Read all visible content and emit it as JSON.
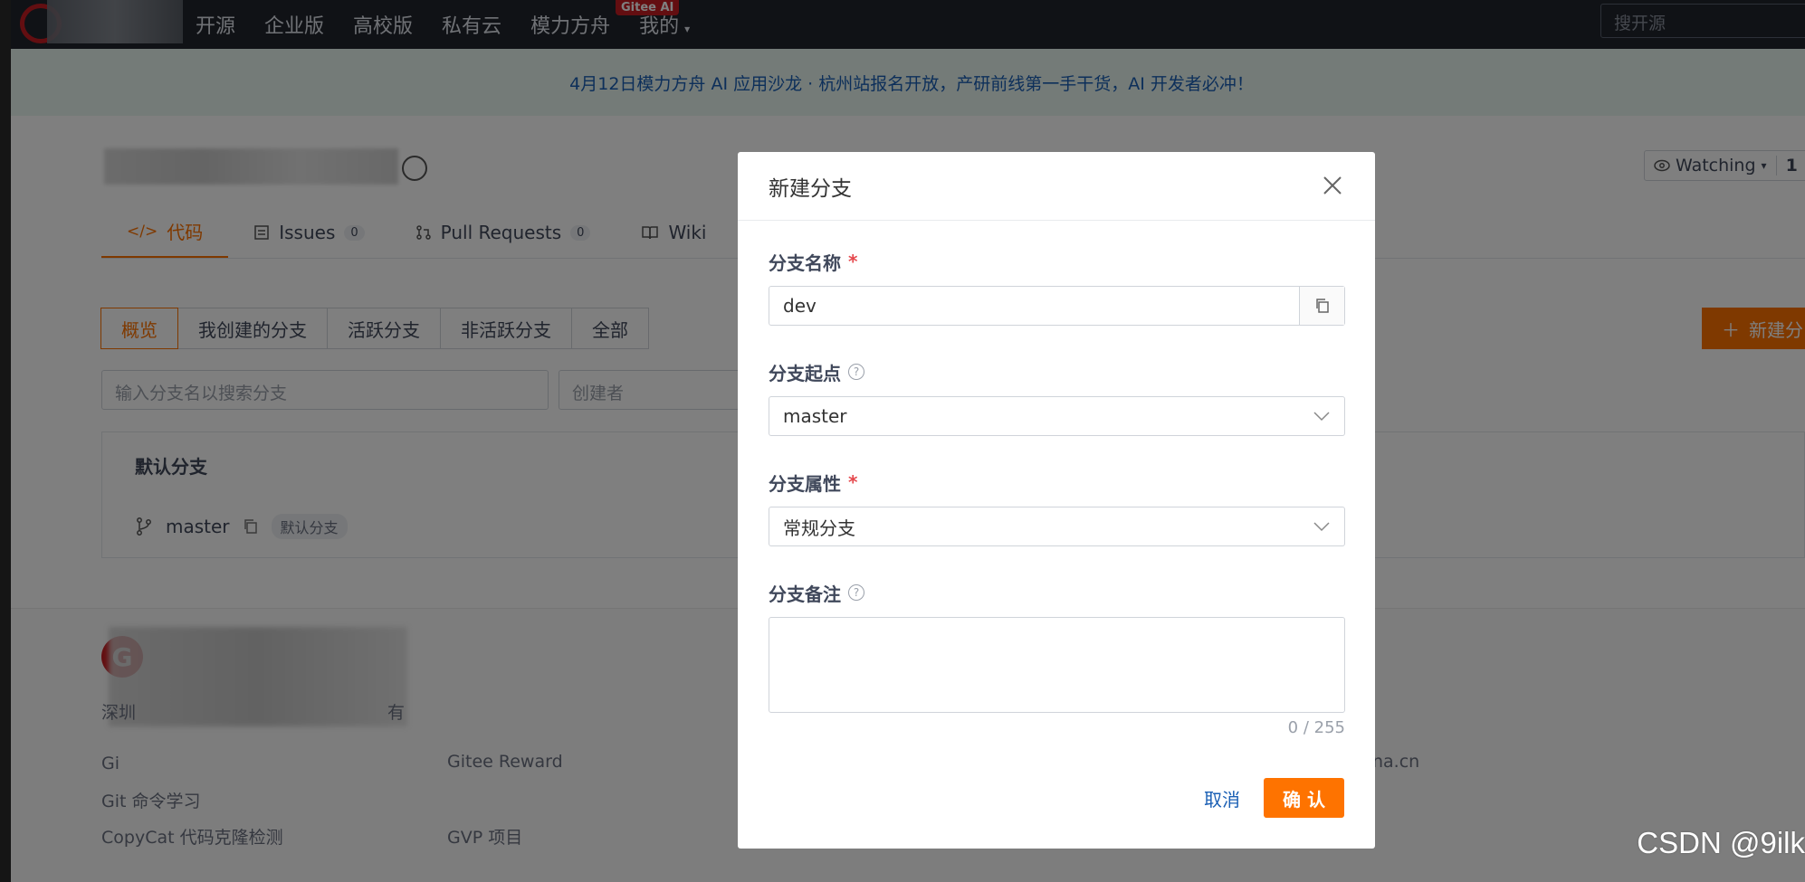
{
  "nav": {
    "items": [
      "开源",
      "企业版",
      "高校版",
      "私有云",
      "模力方舟",
      "我的"
    ],
    "badge": "Gitee AI",
    "search_placeholder": "搜开源"
  },
  "banner": {
    "text": "4月12日模力方舟 AI 应用沙龙 · 杭州站报名开放，产研前线第一手干货，AI 开发者必冲！"
  },
  "repo": {
    "tabs": [
      {
        "label": "代码",
        "icon": "code-icon"
      },
      {
        "label": "Issues",
        "count": "0",
        "icon": "issues-icon"
      },
      {
        "label": "Pull Requests",
        "count": "0",
        "icon": "pull-request-icon"
      },
      {
        "label": "Wiki",
        "icon": "wiki-icon"
      }
    ],
    "watching_label": "Watching",
    "watching_count": "1"
  },
  "branches": {
    "filter_tabs": [
      "概览",
      "我创建的分支",
      "活跃分支",
      "非活跃分支",
      "全部"
    ],
    "new_button": "新建分",
    "search_placeholder": "输入分支名以搜索分支",
    "creator_placeholder": "创建者",
    "default_title": "默认分支",
    "default_branch": "master",
    "default_badge": "默认分支"
  },
  "footer": {
    "lines": [
      "深圳",
      "有",
      "Gi",
      "Git 命令学习",
      "CopyCat 代码克隆检测",
      "GVP 项目",
      "Gitee Reward",
      "na.cn"
    ]
  },
  "modal": {
    "title": "新建分支",
    "name_label": "分支名称",
    "name_value": "dev",
    "origin_label": "分支起点",
    "origin_value": "master",
    "attr_label": "分支属性",
    "attr_value": "常规分支",
    "note_label": "分支备注",
    "counter": "0 / 255",
    "cancel": "取消",
    "confirm": "确 认"
  },
  "watermark": "CSDN @9ilk",
  "colors": {
    "accent": "#fe7300",
    "nav_bg": "#20242d",
    "link": "#1a5fb4",
    "banner_bg": "#e8f6f0",
    "required": "#e5484d"
  }
}
